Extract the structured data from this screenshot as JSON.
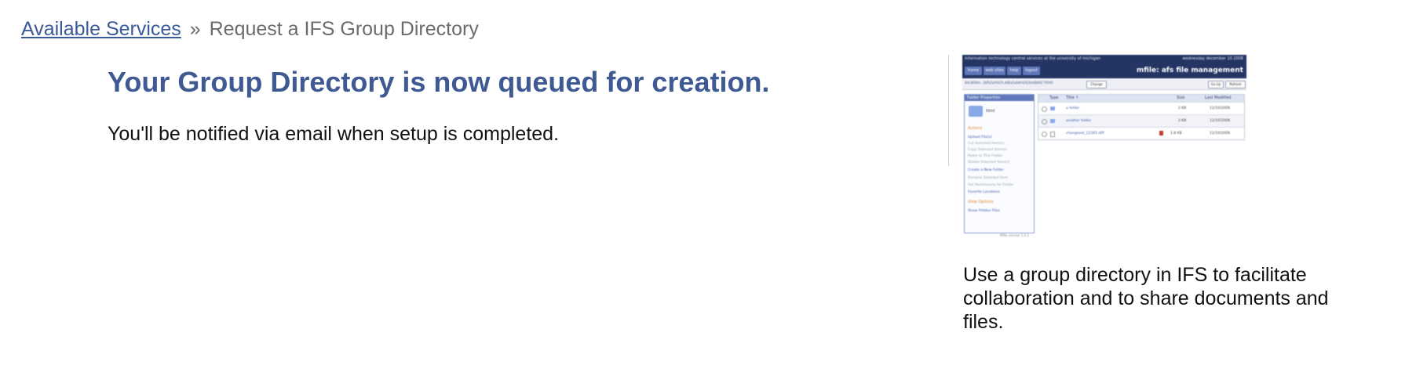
{
  "breadcrumb": {
    "parent_link": "Available Services",
    "separator": "»",
    "current": "Request a IFS Group Directory"
  },
  "main": {
    "heading": "Your Group Directory is now queued for creation.",
    "message": "You'll be notified via email when setup is completed."
  },
  "promo": {
    "caption": "Use a group directory in IFS to facilitate collaboration and to share documents and files.",
    "thumbnail": {
      "header_left": "information technology central services at the university of michigan",
      "header_right": "wednesday december 10 2008",
      "app_title": "mfile: afs file management",
      "nav": [
        "home",
        "web sites",
        "help",
        "logout"
      ],
      "location": "location: /afs/umich.edu/users/s/sosbot/ html",
      "change_button": "Change",
      "go_up_button": "Go Up",
      "refresh_button": "Refresh",
      "sidebar_title": "Folder Properties",
      "folder_name": "html",
      "actions_heading": "Actions",
      "actions": [
        {
          "label": "Upload File(s)",
          "enabled": true
        },
        {
          "label": "Cut Selected Item(s)",
          "enabled": false
        },
        {
          "label": "Copy Selected Item(s)",
          "enabled": false
        },
        {
          "label": "Paste to This Folder",
          "enabled": false
        },
        {
          "label": "Delete Selected Item(s)",
          "enabled": false
        },
        {
          "label": "Create a New Folder",
          "enabled": true
        },
        {
          "label": "Rename Selected Item",
          "enabled": false
        },
        {
          "label": "Set Permissions for Folder",
          "enabled": false
        },
        {
          "label": "Favorite Locations",
          "enabled": true
        }
      ],
      "view_heading": "View Options",
      "view_option": "Show Hidden Files",
      "version": "Mfile version 1.0.2",
      "columns": [
        "Type",
        "Title ↑",
        "Size",
        "Last Modified"
      ],
      "rows": [
        {
          "name": "a folder",
          "size": "2 KB",
          "modified": "12/10/2008",
          "kind": "folder"
        },
        {
          "name": "another folder",
          "size": "2 KB",
          "modified": "12/10/2008",
          "kind": "folder"
        },
        {
          "name": "changeset_12345.diff",
          "size": "1.8 KB",
          "modified": "12/10/2008",
          "kind": "file"
        }
      ]
    }
  }
}
